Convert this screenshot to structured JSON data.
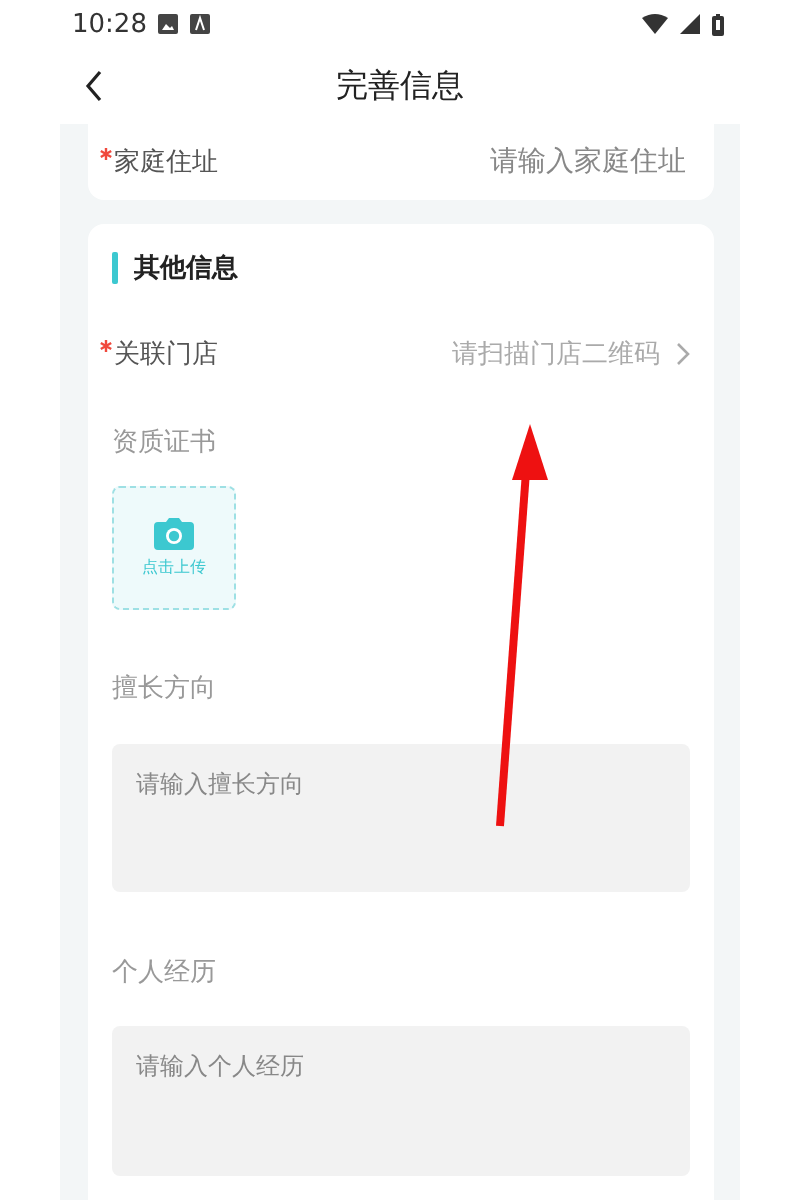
{
  "status_bar": {
    "time": "10:28"
  },
  "nav": {
    "title": "完善信息"
  },
  "address": {
    "label": "家庭住址",
    "required": true,
    "placeholder": "请输入家庭住址"
  },
  "section": {
    "title": "其他信息",
    "fields": [
      {
        "kind": "picker",
        "label": "关联门店",
        "required": true,
        "placeholder": "请扫描门店二维码"
      },
      {
        "kind": "upload",
        "label": "资质证书",
        "required": false,
        "button": "点击上传"
      },
      {
        "kind": "textarea",
        "label": "擅长方向",
        "required": false,
        "placeholder": "请输入擅长方向"
      },
      {
        "kind": "textarea",
        "label": "个人经历",
        "required": false,
        "placeholder": "请输入个人经历"
      }
    ]
  }
}
